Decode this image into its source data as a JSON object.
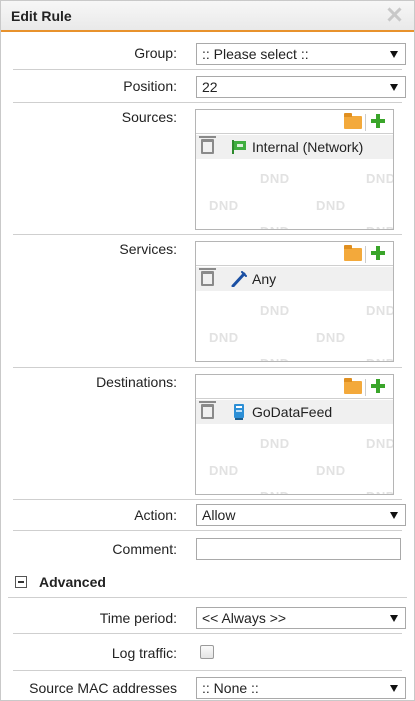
{
  "dialog": {
    "title": "Edit Rule",
    "accent_color": "#e8922c"
  },
  "fields": {
    "group": {
      "label": "Group:",
      "value": ":: Please select ::"
    },
    "position": {
      "label": "Position:",
      "value": "22"
    },
    "sources": {
      "label": "Sources:",
      "item": "Internal (Network)",
      "item_icon": "network-flag-icon"
    },
    "services": {
      "label": "Services:",
      "item": "Any",
      "item_icon": "any-service-icon"
    },
    "destinations": {
      "label": "Destinations:",
      "item": "GoDataFeed",
      "item_icon": "host-device-icon"
    },
    "action": {
      "label": "Action:",
      "value": "Allow"
    },
    "comment": {
      "label": "Comment:",
      "value": ""
    }
  },
  "dnd_watermark": "DND",
  "advanced": {
    "title": "Advanced",
    "time_period": {
      "label": "Time period:",
      "value": "<< Always >>"
    },
    "log_traffic": {
      "label": "Log traffic:",
      "checked": false
    },
    "source_mac": {
      "label": "Source MAC addresses",
      "value": ":: None ::"
    }
  }
}
